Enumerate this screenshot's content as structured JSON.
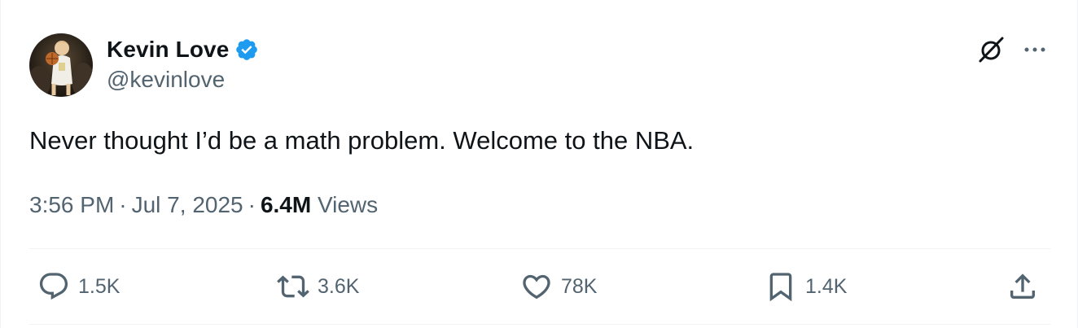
{
  "author": {
    "display_name": "Kevin Love",
    "handle": "@kevinlove",
    "verified": true,
    "verified_color": "#1d9bf0"
  },
  "tweet": {
    "text": "Never thought I’d be a math problem. Welcome to the NBA.",
    "time": "3:56 PM",
    "date": "Jul 7, 2025",
    "views_count": "6.4M",
    "views_label": "Views"
  },
  "actions": {
    "reply": {
      "count": "1.5K",
      "icon": "reply-icon"
    },
    "retweet": {
      "count": "3.6K",
      "icon": "retweet-icon"
    },
    "like": {
      "count": "78K",
      "icon": "heart-icon"
    },
    "bookmark": {
      "count": "1.4K",
      "icon": "bookmark-icon"
    },
    "share": {
      "icon": "share-icon"
    }
  },
  "header_buttons": {
    "grok": {
      "icon": "grok-icon"
    },
    "more": {
      "icon": "more-icon"
    }
  },
  "colors": {
    "text_primary": "#0f1419",
    "text_secondary": "#536471",
    "divider": "#eff3f4"
  }
}
